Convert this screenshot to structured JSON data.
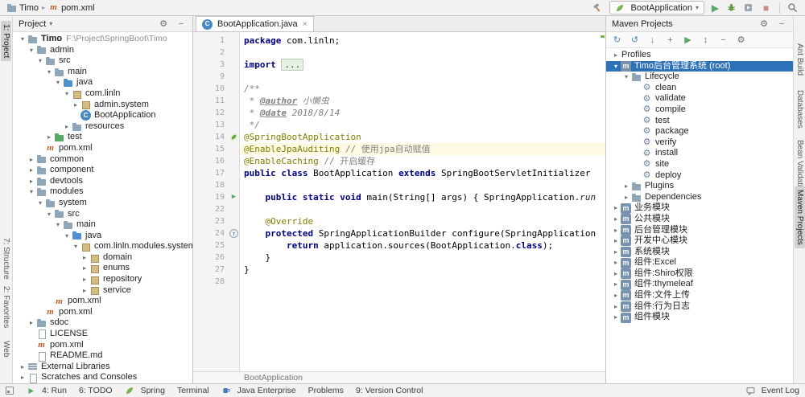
{
  "glyphs": {
    "play": "▶",
    "stop": "■",
    "dropdown": "▾",
    "chevron_open": "▾",
    "chevron_closed": "▸",
    "close": "×",
    "minus": "−",
    "gear": "⚙"
  },
  "colors": {
    "selection_blue": "#2d72b9",
    "caret_line": "#fffae3",
    "keyword": "#000080",
    "annotation": "#808000",
    "comment": "#808080",
    "run_green": "#59a869",
    "maven_orange": "#bf5c2b"
  },
  "topbar": {
    "nav": [
      {
        "label": "Timo",
        "icon": "folder-icon"
      },
      {
        "label": "pom.xml",
        "icon": "maven-icon"
      }
    ],
    "run_config": {
      "label": "BootApplication",
      "icon": "spring-leaf-icon"
    },
    "actions_left": [
      {
        "name": "build-hammer-icon"
      }
    ],
    "actions_right": [
      {
        "name": "run-button",
        "glyph": "▶",
        "color": "#59a869"
      },
      {
        "name": "debug-button"
      },
      {
        "name": "coverage-button"
      },
      {
        "name": "stop-button",
        "glyph": "■",
        "color": "#c98a8a"
      }
    ],
    "corner": [
      {
        "name": "search-everywhere-icon"
      }
    ]
  },
  "stripes": {
    "left": [
      {
        "label": "1: Project",
        "active": true
      },
      {
        "label": "7: Structure"
      },
      {
        "label": "2: Favorites"
      },
      {
        "label": "Web"
      }
    ],
    "right": [
      {
        "label": "Ant Build"
      },
      {
        "label": "Databases"
      },
      {
        "label": "Bean Validation"
      },
      {
        "label": "Maven Projects",
        "active": true
      }
    ]
  },
  "project_panel": {
    "title": "Project",
    "header_icons": [
      {
        "name": "settings-icon",
        "glyph": "⚙"
      },
      {
        "name": "hide-panel-icon",
        "glyph": "−"
      }
    ],
    "items": [
      {
        "label": "Timo",
        "sublabel": "F:\\Project\\SpringBoot\\Timo",
        "icon": "folder-icon",
        "level": 0,
        "chevron": "open",
        "bold": true
      },
      {
        "label": "admin",
        "icon": "folder-icon",
        "level": 1,
        "chevron": "open"
      },
      {
        "label": "src",
        "icon": "folder-icon",
        "level": 2,
        "chevron": "open"
      },
      {
        "label": "main",
        "icon": "folder-icon",
        "level": 3,
        "chevron": "open"
      },
      {
        "label": "java",
        "icon": "source-folder-icon",
        "level": 4,
        "chevron": "open"
      },
      {
        "label": "com.linln",
        "icon": "package-icon",
        "level": 5,
        "chevron": "open"
      },
      {
        "label": "admin.system",
        "icon": "package-icon",
        "level": 6,
        "chevron": "closed"
      },
      {
        "label": "BootApplication",
        "icon": "class-icon",
        "level": 6,
        "chevron": "none"
      },
      {
        "label": "resources",
        "icon": "folder-icon",
        "level": 5,
        "chevron": "closed"
      },
      {
        "label": "test",
        "icon": "test-folder-icon",
        "level": 3,
        "chevron": "closed"
      },
      {
        "label": "pom.xml",
        "icon": "maven-icon",
        "level": 2,
        "chevron": "none"
      },
      {
        "label": "common",
        "icon": "folder-icon",
        "level": 1,
        "chevron": "closed"
      },
      {
        "label": "component",
        "icon": "folder-icon",
        "level": 1,
        "chevron": "closed"
      },
      {
        "label": "devtools",
        "icon": "folder-icon",
        "level": 1,
        "chevron": "closed"
      },
      {
        "label": "modules",
        "icon": "folder-icon",
        "level": 1,
        "chevron": "open"
      },
      {
        "label": "system",
        "icon": "folder-icon",
        "level": 2,
        "chevron": "open"
      },
      {
        "label": "src",
        "icon": "folder-icon",
        "level": 3,
        "chevron": "open"
      },
      {
        "label": "main",
        "icon": "folder-icon",
        "level": 4,
        "chevron": "open"
      },
      {
        "label": "java",
        "icon": "source-folder-icon",
        "level": 5,
        "chevron": "open"
      },
      {
        "label": "com.linln.modules.system",
        "icon": "package-icon",
        "level": 6,
        "chevron": "open"
      },
      {
        "label": "domain",
        "icon": "package-icon",
        "level": 7,
        "chevron": "closed"
      },
      {
        "label": "enums",
        "icon": "package-icon",
        "level": 7,
        "chevron": "closed"
      },
      {
        "label": "repository",
        "icon": "package-icon",
        "level": 7,
        "chevron": "closed"
      },
      {
        "label": "service",
        "icon": "package-icon",
        "level": 7,
        "chevron": "closed"
      },
      {
        "label": "pom.xml",
        "icon": "maven-icon",
        "level": 3,
        "chevron": "none"
      },
      {
        "label": "pom.xml",
        "icon": "maven-icon",
        "level": 2,
        "chevron": "none"
      },
      {
        "label": "sdoc",
        "icon": "folder-icon",
        "level": 1,
        "chevron": "closed"
      },
      {
        "label": "LICENSE",
        "icon": "file-icon",
        "level": 1,
        "chevron": "none"
      },
      {
        "label": "pom.xml",
        "icon": "maven-icon",
        "level": 1,
        "chevron": "none"
      },
      {
        "label": "README.md",
        "icon": "file-icon",
        "level": 1,
        "chevron": "none"
      },
      {
        "label": "External Libraries",
        "icon": "library-icon",
        "level": 0,
        "chevron": "closed"
      },
      {
        "label": "Scratches and Consoles",
        "icon": "scratch-icon",
        "level": 0,
        "chevron": "closed"
      }
    ]
  },
  "editor": {
    "tab": {
      "label": "BootApplication.java",
      "icon": "class-icon"
    },
    "breadcrumb": "BootApplication",
    "lines": [
      {
        "n": 1,
        "seg": [
          [
            "kw",
            "package "
          ],
          [
            "pl",
            "com.linln;"
          ]
        ]
      },
      {
        "n": 2,
        "seg": []
      },
      {
        "n": 3,
        "seg": [
          [
            "kw",
            "import "
          ],
          [
            "fold",
            "..."
          ]
        ]
      },
      {
        "n": 9,
        "seg": []
      },
      {
        "n": 10,
        "seg": [
          [
            "doc",
            "/**"
          ]
        ]
      },
      {
        "n": 11,
        "seg": [
          [
            "doc",
            " * "
          ],
          [
            "doctag",
            "@author"
          ],
          [
            "doc",
            " 小懒虫"
          ]
        ]
      },
      {
        "n": 12,
        "seg": [
          [
            "doc",
            " * "
          ],
          [
            "doctag",
            "@date"
          ],
          [
            "doc",
            " 2018/8/14"
          ]
        ]
      },
      {
        "n": 13,
        "seg": [
          [
            "doc",
            " */"
          ]
        ]
      },
      {
        "n": 14,
        "gutter": "spring-bean-icon",
        "seg": [
          [
            "anno",
            "@SpringBootApplication"
          ]
        ]
      },
      {
        "n": 15,
        "caret": true,
        "seg": [
          [
            "anno",
            "@EnableJpaAuditing "
          ],
          [
            "cmt",
            "// 使用jpa自动赋值"
          ]
        ]
      },
      {
        "n": 16,
        "seg": [
          [
            "anno",
            "@EnableCaching "
          ],
          [
            "cmt",
            "// 开启缓存"
          ]
        ]
      },
      {
        "n": 17,
        "seg": [
          [
            "kw",
            "public class "
          ],
          [
            "pl",
            "BootApplication "
          ],
          [
            "kw",
            "extends "
          ],
          [
            "pl",
            "SpringBootServletInitializer"
          ]
        ]
      },
      {
        "n": 18,
        "seg": []
      },
      {
        "n": 19,
        "gutter": "run-gutter-icon",
        "seg": [
          [
            "pl",
            "    "
          ],
          [
            "kw",
            "public static void "
          ],
          [
            "pl",
            "main(String[] args) { SpringApplication."
          ],
          [
            "smethod",
            "run"
          ]
        ]
      },
      {
        "n": 22,
        "seg": []
      },
      {
        "n": 23,
        "seg": [
          [
            "pl",
            "    "
          ],
          [
            "anno",
            "@Override"
          ]
        ]
      },
      {
        "n": 24,
        "gutter": "override-gutter-icon",
        "seg": [
          [
            "pl",
            "    "
          ],
          [
            "kw",
            "protected "
          ],
          [
            "pl",
            "SpringApplicationBuilder configure(SpringApplication"
          ]
        ]
      },
      {
        "n": 25,
        "seg": [
          [
            "pl",
            "        "
          ],
          [
            "kw",
            "return "
          ],
          [
            "pl",
            "application.sources(BootApplication."
          ],
          [
            "kw",
            "class"
          ],
          [
            "pl",
            ");"
          ]
        ]
      },
      {
        "n": 26,
        "seg": [
          [
            "pl",
            "    }"
          ]
        ]
      },
      {
        "n": 27,
        "seg": [
          [
            "pl",
            "}"
          ]
        ]
      },
      {
        "n": 28,
        "seg": []
      }
    ]
  },
  "maven_panel": {
    "title": "Maven Projects",
    "header_icons": [
      {
        "name": "settings-icon",
        "glyph": "⚙"
      },
      {
        "name": "hide-panel-icon",
        "glyph": "−"
      }
    ],
    "toolbar": [
      {
        "name": "reimport-maven-icon",
        "glyph": "↻",
        "color": "#4a88c7"
      },
      {
        "name": "generate-sources-icon",
        "glyph": "↺",
        "color": "#4a88c7"
      },
      {
        "name": "download-sources-icon",
        "glyph": "↓",
        "color": "#6e6e6e"
      },
      {
        "name": "add-maven-project-icon",
        "glyph": "+",
        "color": "#6e6e6e"
      },
      {
        "name": "execute-goal-icon",
        "glyph": "▶",
        "color": "#59a869"
      },
      {
        "name": "expand-all-icon",
        "glyph": "↕",
        "color": "#6e6e6e"
      },
      {
        "name": "collapse-all-icon",
        "glyph": "−",
        "color": "#6e6e6e"
      },
      {
        "name": "maven-settings-icon",
        "glyph": "⚙",
        "color": "#6e6e6e"
      }
    ],
    "items": [
      {
        "label": "Profiles",
        "icon": null,
        "level": 0,
        "chevron": "closed"
      },
      {
        "label": "Timo后台管理系统 (root)",
        "icon": "maven-project-icon",
        "level": 0,
        "chevron": "open",
        "selected": true
      },
      {
        "label": "Lifecycle",
        "icon": "folder-icon",
        "level": 1,
        "chevron": "open"
      },
      {
        "label": "clean",
        "icon": "goal-icon",
        "level": 2,
        "chevron": "none"
      },
      {
        "label": "validate",
        "icon": "goal-icon",
        "level": 2,
        "chevron": "none"
      },
      {
        "label": "compile",
        "icon": "goal-icon",
        "level": 2,
        "chevron": "none"
      },
      {
        "label": "test",
        "icon": "goal-icon",
        "level": 2,
        "chevron": "none"
      },
      {
        "label": "package",
        "icon": "goal-icon",
        "level": 2,
        "chevron": "none"
      },
      {
        "label": "verify",
        "icon": "goal-icon",
        "level": 2,
        "chevron": "none"
      },
      {
        "label": "install",
        "icon": "goal-icon",
        "level": 2,
        "chevron": "none"
      },
      {
        "label": "site",
        "icon": "goal-icon",
        "level": 2,
        "chevron": "none"
      },
      {
        "label": "deploy",
        "icon": "goal-icon",
        "level": 2,
        "chevron": "none"
      },
      {
        "label": "Plugins",
        "icon": "folder-icon",
        "level": 1,
        "chevron": "closed"
      },
      {
        "label": "Dependencies",
        "icon": "folder-icon",
        "level": 1,
        "chevron": "closed"
      },
      {
        "label": "业务模块",
        "icon": "maven-module-icon",
        "level": 0,
        "chevron": "closed"
      },
      {
        "label": "公共模块",
        "icon": "maven-module-icon",
        "level": 0,
        "chevron": "closed"
      },
      {
        "label": "后台管理模块",
        "icon": "maven-module-icon",
        "level": 0,
        "chevron": "closed"
      },
      {
        "label": "开发中心模块",
        "icon": "maven-module-icon",
        "level": 0,
        "chevron": "closed"
      },
      {
        "label": "系统模块",
        "icon": "maven-module-icon",
        "level": 0,
        "chevron": "closed"
      },
      {
        "label": "组件:Excel",
        "icon": "maven-module-icon",
        "level": 0,
        "chevron": "closed"
      },
      {
        "label": "组件:Shiro权限",
        "icon": "maven-module-icon",
        "level": 0,
        "chevron": "closed"
      },
      {
        "label": "组件:thymeleaf",
        "icon": "maven-module-icon",
        "level": 0,
        "chevron": "closed"
      },
      {
        "label": "组件:文件上传",
        "icon": "maven-module-icon",
        "level": 0,
        "chevron": "closed"
      },
      {
        "label": "组件:行为日志",
        "icon": "maven-module-icon",
        "level": 0,
        "chevron": "closed"
      },
      {
        "label": "组件模块",
        "icon": "maven-module-icon",
        "level": 0,
        "chevron": "closed"
      }
    ]
  },
  "statusbar": {
    "left_items": [
      {
        "label": "4: Run",
        "icon": "run-small-icon"
      },
      {
        "label": "6: TODO",
        "icon": null
      },
      {
        "label": "Spring",
        "icon": "spring-leaf-icon"
      },
      {
        "label": "Terminal",
        "icon": null
      },
      {
        "label": "Java Enterprise",
        "icon": "java-ee-icon"
      },
      {
        "label": "Problems",
        "icon": null
      },
      {
        "label": "9: Version Control",
        "icon": null
      }
    ],
    "right_items": [
      {
        "label": "Event Log",
        "icon": "event-log-icon"
      }
    ]
  }
}
